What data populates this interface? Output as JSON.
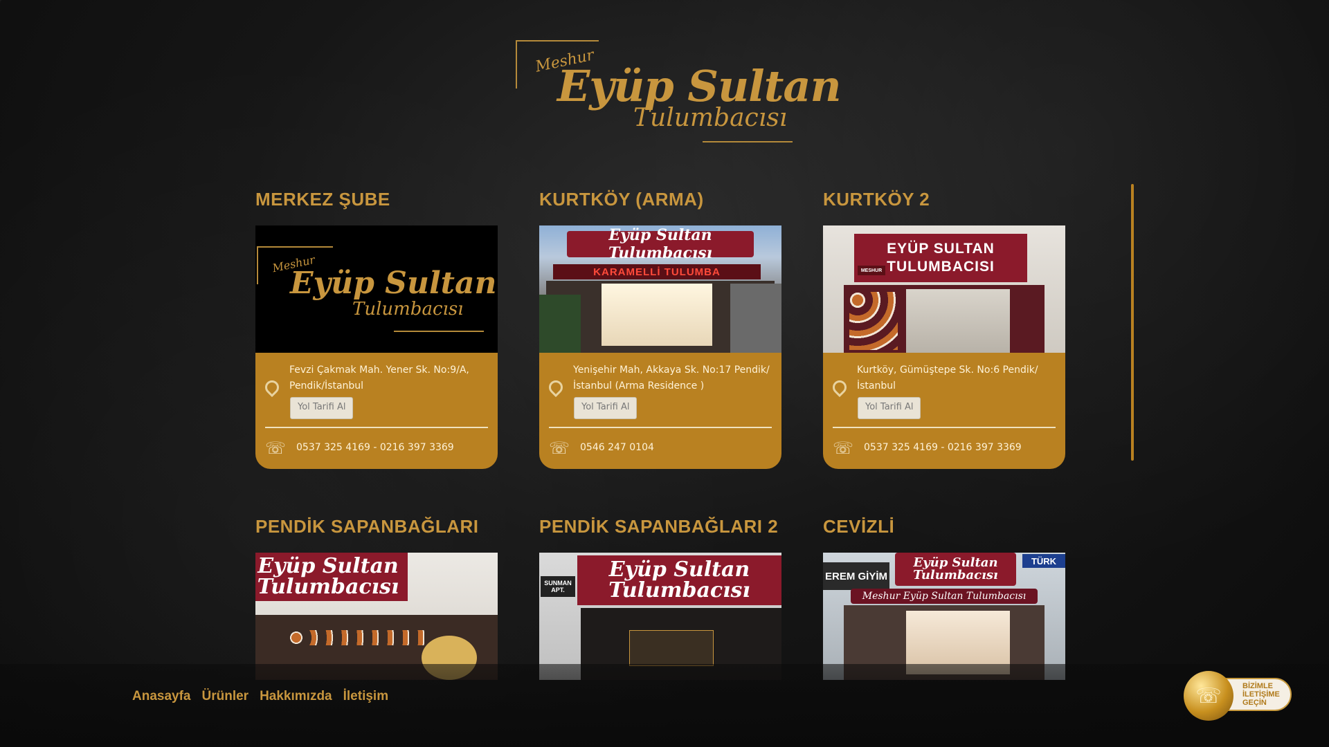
{
  "brand": {
    "logo_top": "Meshur",
    "logo_main": "Eyüp Sultan",
    "logo_sub": "Tulumbacısı"
  },
  "branches": [
    {
      "title": "MERKEZ ŞUBE",
      "address": "Fevzi Çakmak Mah. Yener Sk. No:9/A, Pendik/İstanbul",
      "route_label": "Yol Tarifi Al",
      "phone": "0537 325 4169 - 0216 397 3369"
    },
    {
      "title": "KURTKÖY (ARMA)",
      "address": "Yenişehir Mah, Akkaya Sk. No:17 Pendik/ İstanbul (Arma Residence )",
      "route_label": "Yol Tarifi Al",
      "phone": "0546 247 0104",
      "sign_top": "Eyüp Sultan Tulumbacısı",
      "sign_bottom": "KARAMELLİ TULUMBA"
    },
    {
      "title": "KURTKÖY 2",
      "address": "Kurtköy, Gümüştepe Sk. No:6 Pendik/ İstanbul",
      "route_label": "Yol Tarifi Al",
      "phone": "0537 325 4169 - 0216 397 3369",
      "sign": "EYÜP SULTAN TULUMBACISI",
      "sign_badge": "MESHUR"
    },
    {
      "title": "PENDİK SAPANBAĞLARI",
      "sign": "Eyüp Sultan Tulumbacısı"
    },
    {
      "title": "PENDİK SAPANBAĞLARI 2",
      "sign": "Eyüp Sultan Tulumbacısı",
      "apt_label": "SUNMAN APT."
    },
    {
      "title": "CEVİZLİ",
      "sign": "Eyüp Sultan Tulumbacısı",
      "neighbor_left": "EREM GİYİM",
      "neighbor_right": "TÜRK",
      "banner": "Meshur Eyüp Sultan Tulumbacısı"
    }
  ],
  "nav": {
    "home": "Anasayfa",
    "products": "Ürünler",
    "about": "Hakkımızda",
    "contact": "İletişim"
  },
  "contact_button": {
    "label": "BİZİMLE İLETİŞİME GEÇİN",
    "icon": "phone-icon"
  },
  "colors": {
    "accent": "#c8963e",
    "card": "#b98121"
  }
}
